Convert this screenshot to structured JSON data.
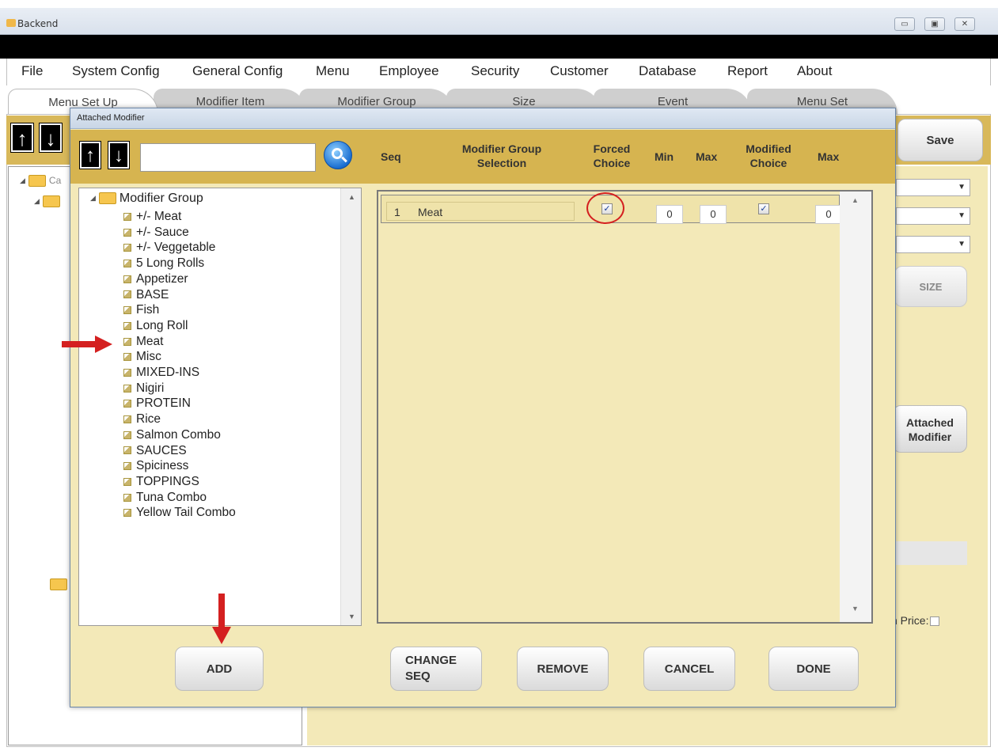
{
  "window": {
    "title": "Backend"
  },
  "menubar": [
    "File",
    "System Config",
    "General Config",
    "Menu",
    "Employee",
    "Security",
    "Customer",
    "Database",
    "Report",
    "About"
  ],
  "tabs": [
    "Menu Set Up",
    "Modifier Item",
    "Modifier Group",
    "Size",
    "Event",
    "Menu Set"
  ],
  "background": {
    "save_label": "Save",
    "size_label": "SIZE",
    "attached_modifier_label": "Attached Modifier",
    "tree_root_prefix": "Ca",
    "open_price_label": "n Price:"
  },
  "dialog": {
    "title": "Attached Modifier",
    "search": {
      "value": "",
      "placeholder": ""
    },
    "columns": {
      "seq": "Seq",
      "selection": "Modifier Group Selection",
      "forced": "Forced Choice",
      "min": "Min",
      "max": "Max",
      "modified": "Modified Choice",
      "max2": "Max"
    },
    "tree": {
      "root": "Modifier Group",
      "items": [
        "+/- Meat",
        "+/- Sauce",
        "+/- Veggetable",
        "5 Long Rolls",
        "Appetizer",
        "BASE",
        "Fish",
        "Long Roll",
        "Meat",
        "Misc",
        "MIXED-INS",
        "Nigiri",
        "PROTEIN",
        "Rice",
        "Salmon Combo",
        "SAUCES",
        "Spiciness",
        "TOPPINGS",
        "Tuna Combo",
        "Yellow Tail Combo"
      ]
    },
    "rows": [
      {
        "seq": "1",
        "selection": "Meat",
        "forced": true,
        "min": "0",
        "max": "0",
        "modified": true,
        "max2": "0"
      }
    ],
    "buttons": {
      "add": "ADD",
      "change_seq": "CHANGE SEQ",
      "remove": "REMOVE",
      "cancel": "CANCEL",
      "done": "DONE"
    }
  },
  "annotation_color": "#d42020"
}
